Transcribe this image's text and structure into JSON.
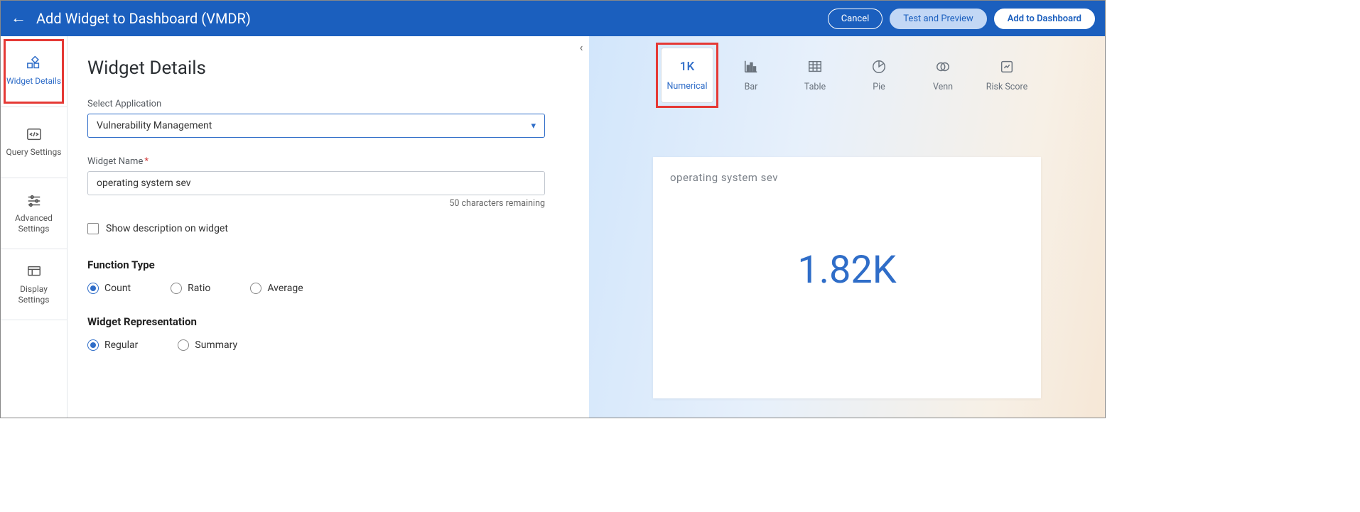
{
  "header": {
    "title": "Add Widget to Dashboard (VMDR)",
    "cancel": "Cancel",
    "test": "Test and Preview",
    "add": "Add to Dashboard"
  },
  "sidebar": {
    "items": [
      {
        "label": "Widget Details",
        "active": true
      },
      {
        "label": "Query Settings",
        "active": false
      },
      {
        "label": "Advanced Settings",
        "active": false
      },
      {
        "label": "Display Settings",
        "active": false
      }
    ]
  },
  "form": {
    "heading": "Widget Details",
    "select_application_label": "Select Application",
    "select_application_value": "Vulnerability Management",
    "widget_name_label": "Widget Name",
    "widget_name_value": "operating system sev",
    "widget_name_helper": "50 characters remaining",
    "show_description_label": "Show description on widget",
    "function_type_label": "Function Type",
    "function_type_options": {
      "count": "Count",
      "ratio": "Ratio",
      "average": "Average"
    },
    "function_type_selected": "count",
    "widget_representation_label": "Widget Representation",
    "widget_representation_options": {
      "regular": "Regular",
      "summary": "Summary"
    },
    "widget_representation_selected": "regular"
  },
  "preview": {
    "types": {
      "numerical": {
        "icon_text": "1K",
        "label": "Numerical"
      },
      "bar": "Bar",
      "table": "Table",
      "pie": "Pie",
      "venn": "Venn",
      "risk": "Risk Score"
    },
    "selected_type": "numerical",
    "card_title": "operating system sev",
    "card_value": "1.82K"
  }
}
